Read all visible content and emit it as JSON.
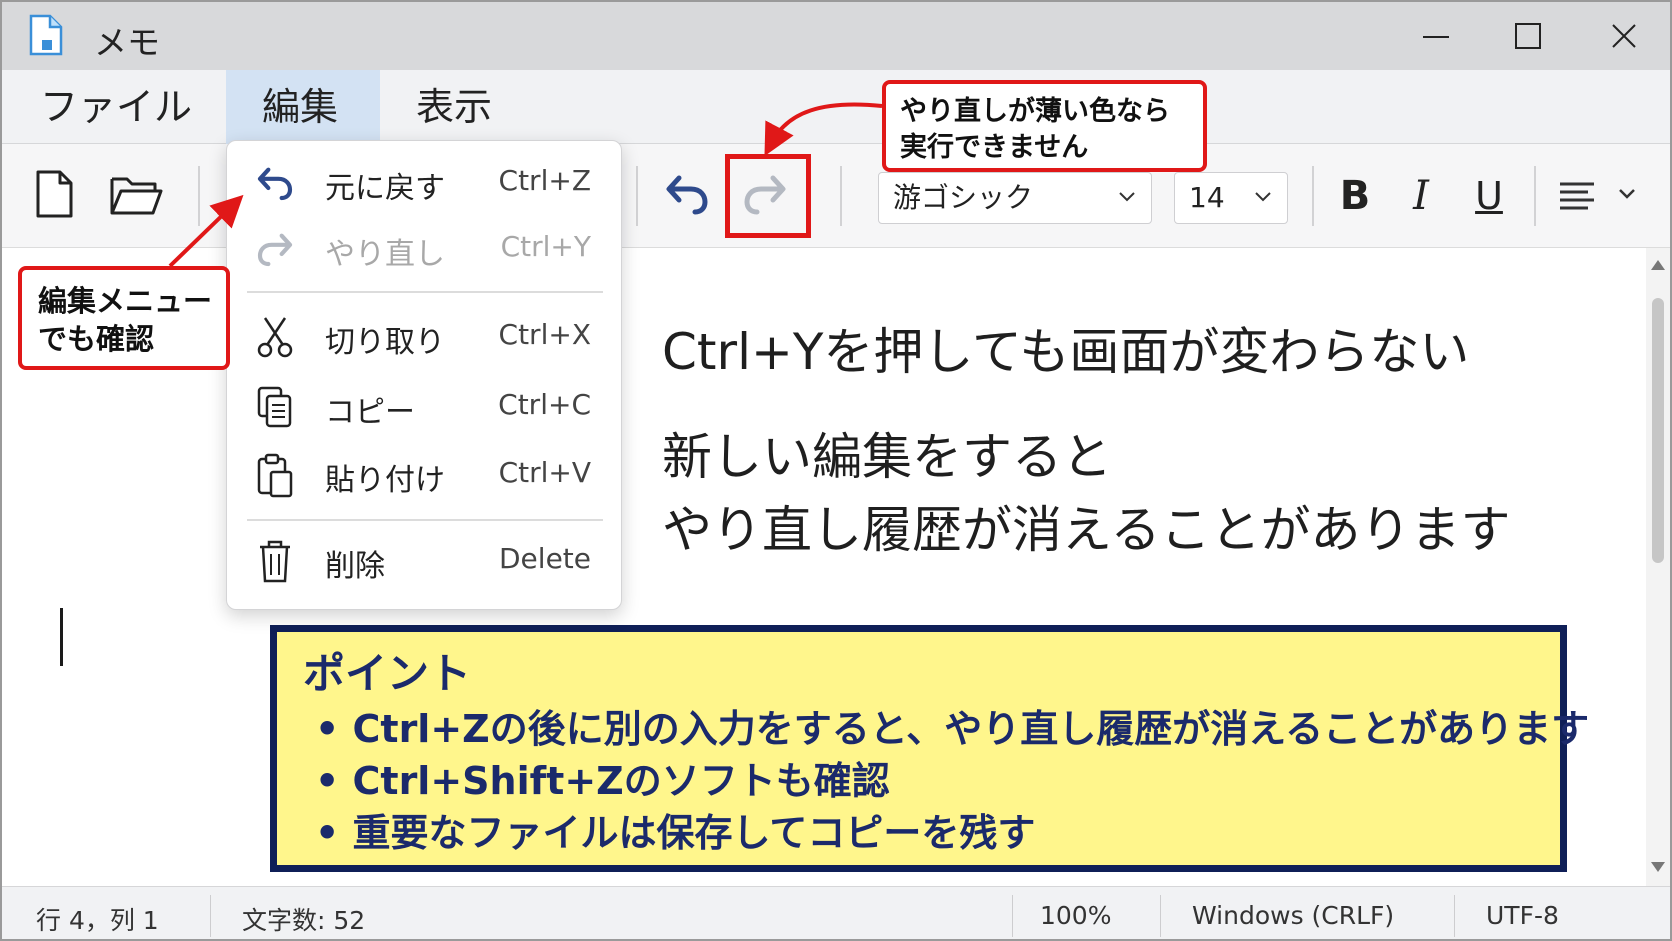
{
  "window": {
    "title": "メモ"
  },
  "menubar": {
    "items": [
      {
        "label": "ファイル"
      },
      {
        "label": "編集",
        "active": true
      },
      {
        "label": "表示"
      }
    ]
  },
  "toolbar": {
    "font_select": "游ゴシック",
    "size_select": "14",
    "bold_label": "B",
    "italic_label": "I",
    "underline_label": "U"
  },
  "edit_menu": {
    "items": [
      {
        "label": "元に戻す",
        "shortcut": "Ctrl+Z",
        "icon": "undo-icon",
        "enabled": true
      },
      {
        "label": "やり直し",
        "shortcut": "Ctrl+Y",
        "icon": "redo-icon",
        "enabled": false
      },
      {
        "label": "切り取り",
        "shortcut": "Ctrl+X",
        "icon": "scissors-icon",
        "enabled": true
      },
      {
        "label": "コピー",
        "shortcut": "Ctrl+C",
        "icon": "copy-icon",
        "enabled": true
      },
      {
        "label": "貼り付け",
        "shortcut": "Ctrl+V",
        "icon": "paste-icon",
        "enabled": true
      },
      {
        "label": "削除",
        "shortcut": "Delete",
        "icon": "trash-icon",
        "enabled": true
      }
    ]
  },
  "editor": {
    "line1": "Ctrl+Yを押しても画面が変わらない",
    "line2": "新しい編集をすると",
    "line3": "やり直し履歴が消えることがあります"
  },
  "callouts": {
    "left": [
      "編集メニュー",
      "でも確認"
    ],
    "top": [
      "やり直しが薄い色なら",
      "実行できません"
    ]
  },
  "point": {
    "title": "ポイント",
    "items": [
      "• Ctrl+Zの後に別の入力をすると、やり直し履歴が消えることがあります",
      "• Ctrl+Shift+Zのソフトも確認",
      "• 重要なファイルは保存してコピーを残す"
    ]
  },
  "statusbar": {
    "position": "行 4，列 1",
    "chars": "文字数: 52",
    "zoom": "100%",
    "line_ending": "Windows (CRLF)",
    "encoding": "UTF-8"
  },
  "colors": {
    "accent_red": "#e01818",
    "point_bg": "#fff68c",
    "point_border": "#0f1f57",
    "icon_blue": "#2e4a8c",
    "menu_active": "#d3e2f3"
  }
}
